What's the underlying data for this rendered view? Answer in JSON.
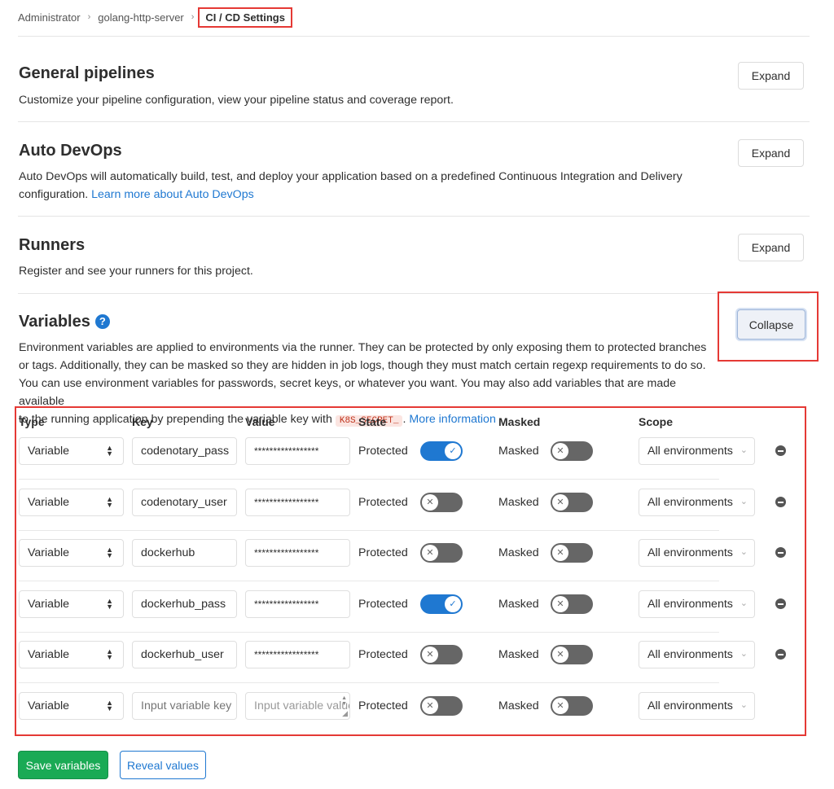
{
  "breadcrumb": {
    "items": [
      "Administrator",
      "golang-http-server"
    ],
    "current": "CI / CD Settings"
  },
  "sections": {
    "general": {
      "title": "General pipelines",
      "desc": "Customize your pipeline configuration, view your pipeline status and coverage report.",
      "button": "Expand"
    },
    "autodevops": {
      "title": "Auto DevOps",
      "desc_line1": "Auto DevOps will automatically build, test, and deploy your application based on a predefined Continuous Integration and Delivery",
      "desc_line2": "configuration.",
      "link": "Learn more about Auto DevOps",
      "button": "Expand"
    },
    "runners": {
      "title": "Runners",
      "desc": "Register and see your runners for this project.",
      "button": "Expand"
    },
    "variables": {
      "title": "Variables",
      "help_icon": "?",
      "button": "Collapse",
      "desc_line1": "Environment variables are applied to environments via the runner. They can be protected by only exposing them to protected branches",
      "desc_line2": "or tags. Additionally, they can be masked so they are hidden in job logs, though they must match certain regexp requirements to do so.",
      "desc_line3": "You can use environment variables for passwords, secret keys, or whatever you want. You may also add variables that are made available",
      "desc_line4_pre": "to the running application by prepending the variable key with",
      "k8s_code": "K8S_SECRET_",
      "desc_line4_post": ".",
      "more_link": "More information"
    }
  },
  "table": {
    "headers": {
      "type": "Type",
      "key": "Key",
      "value": "Value",
      "state": "State",
      "masked": "Masked",
      "scope": "Scope"
    },
    "rows": [
      {
        "type": "Variable",
        "key": "codenotary_pass",
        "value": "*****************",
        "protected_label": "Protected",
        "protected": true,
        "masked_label": "Masked",
        "masked": false,
        "scope": "All environments"
      },
      {
        "type": "Variable",
        "key": "codenotary_user",
        "value": "*****************",
        "protected_label": "Protected",
        "protected": false,
        "masked_label": "Masked",
        "masked": false,
        "scope": "All environments"
      },
      {
        "type": "Variable",
        "key": "dockerhub",
        "value": "*****************",
        "protected_label": "Protected",
        "protected": false,
        "masked_label": "Masked",
        "masked": false,
        "scope": "All environments"
      },
      {
        "type": "Variable",
        "key": "dockerhub_pass",
        "value": "*****************",
        "protected_label": "Protected",
        "protected": true,
        "masked_label": "Masked",
        "masked": false,
        "scope": "All environments"
      },
      {
        "type": "Variable",
        "key": "dockerhub_user",
        "value": "*****************",
        "protected_label": "Protected",
        "protected": false,
        "masked_label": "Masked",
        "masked": false,
        "scope": "All environments"
      }
    ],
    "new_row": {
      "type": "Variable",
      "key_placeholder": "Input variable key",
      "value_placeholder": "Input variable value",
      "protected_label": "Protected",
      "masked_label": "Masked",
      "scope": "All environments"
    }
  },
  "actions": {
    "save": "Save variables",
    "reveal": "Reveal values"
  },
  "colors": {
    "accent_blue": "#1f78d1",
    "save_green": "#1aaa55",
    "highlight_red": "#e53935"
  }
}
